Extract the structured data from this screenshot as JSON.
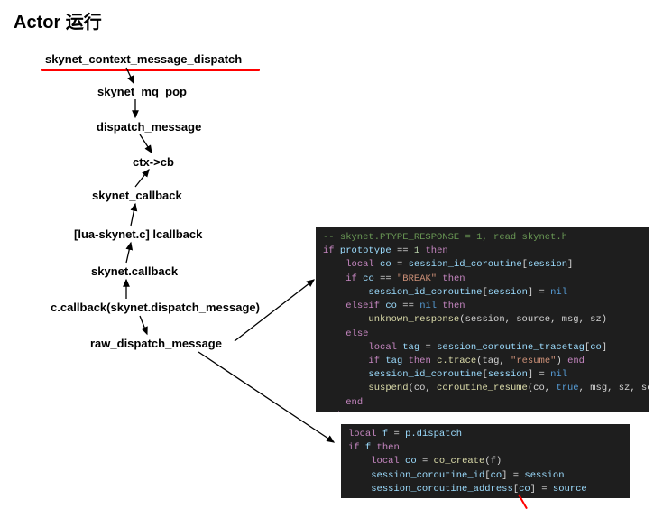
{
  "title": "Actor 运行",
  "nodes": {
    "n1": "skynet_context_message_dispatch",
    "n2": "skynet_mq_pop",
    "n3": "dispatch_message",
    "n4": "ctx->cb",
    "n5": "skynet_callback",
    "n6": "[lua-skynet.c] lcallback",
    "n7": "skynet.callback",
    "n8": "c.callback(skynet.dispatch_message)",
    "n9": "raw_dispatch_message"
  },
  "code1": {
    "cmt": "-- skynet.PTYPE_RESPONSE = 1, read skynet.h",
    "l1_if": "if",
    "l1_var": "prototype",
    "l1_eq": "==",
    "l1_num": "1",
    "l1_then": "then",
    "l2_local": "local",
    "l2_co": "co",
    "l2_eq": "=",
    "l2_sid": "session_id_coroutine",
    "l2_sess": "session",
    "l3_if": "if",
    "l3_co": "co",
    "l3_eq": "==",
    "l3_str": "\"BREAK\"",
    "l3_then": "then",
    "l4_sid": "session_id_coroutine",
    "l4_sess": "session",
    "l4_eq": "=",
    "l4_nil": "nil",
    "l5_elseif": "elseif",
    "l5_co": "co",
    "l5_eq": "==",
    "l5_nil": "nil",
    "l5_then": "then",
    "l6_fn": "unknown_response",
    "l6_args": "(session, source, msg, sz)",
    "l7_else": "else",
    "l8_local": "local",
    "l8_tag": "tag",
    "l8_eq": "=",
    "l8_sct": "session_coroutine_tracetag",
    "l8_co": "co",
    "l9_if": "if",
    "l9_tag": "tag",
    "l9_then": "then",
    "l9_ctrace": "c.trace",
    "l9_args": "(tag, ",
    "l9_str": "\"resume\"",
    "l9_close": ")",
    "l9_end": "end",
    "l10_sid": "session_id_coroutine",
    "l10_sess": "session",
    "l10_eq": "=",
    "l10_nil": "nil",
    "l11_fn": "suspend",
    "l11_open": "(co, ",
    "l11_cr": "coroutine_resume",
    "l11_args": "(co, ",
    "l11_true": "true",
    "l11_rest": ", msg, sz, ses",
    "l12_end": "end",
    "l13_end": "end"
  },
  "code2": {
    "l1_local": "local",
    "l1_f": "f",
    "l1_eq": "=",
    "l1_pd": "p.dispatch",
    "l2_if": "if",
    "l2_f": "f",
    "l2_then": "then",
    "l3_local": "local",
    "l3_co": "co",
    "l3_eq": "=",
    "l3_cc": "co_create",
    "l3_args": "(f)",
    "l4_sci": "session_coroutine_id",
    "l4_co": "co",
    "l4_eq": "=",
    "l4_sess": "session",
    "l5_sca": "session_coroutine_address",
    "l5_co": "co",
    "l5_eq": "=",
    "l5_src": "source"
  }
}
